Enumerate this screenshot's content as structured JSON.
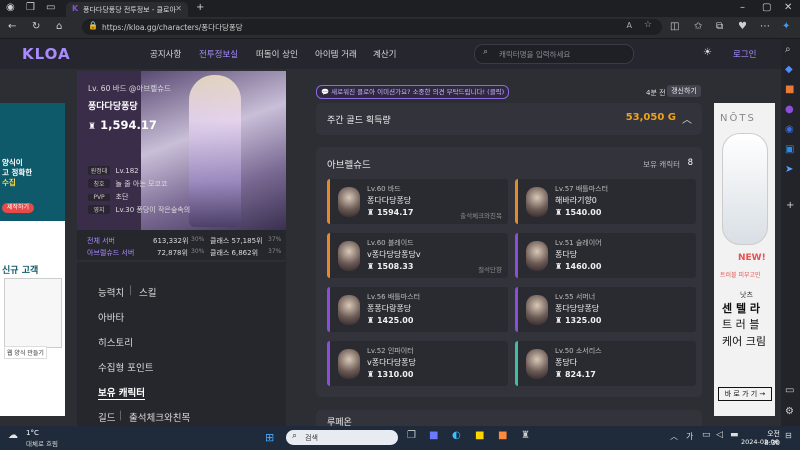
{
  "browser": {
    "tab_title": "퐁다다당퐁당 전투정보 - 클로아",
    "url": "https://kloa.gg/characters/퐁다다당퐁당"
  },
  "nav": {
    "logo": "KLOA",
    "items": [
      "공지사항",
      "전투정보실",
      "떠돌이 상인",
      "아이템 거래",
      "계산기"
    ],
    "search_placeholder": "캐릭터명을 입력하세요",
    "login": "로그인"
  },
  "profile": {
    "level_line": "Lv. 60 바드 @아브렐슈드",
    "name": "퐁다다당퐁당",
    "item_level": "1,594.17",
    "stats": [
      {
        "label": "원정대",
        "value": "Lv.182"
      },
      {
        "label": "칭호",
        "value": "놀 줄 아는 모코코"
      },
      {
        "label": "PVP",
        "value": "초단"
      },
      {
        "label": "영지",
        "value": "Lv.30 퐁당이 작은숲속의"
      }
    ],
    "ranks": [
      {
        "label": "전체 서버",
        "rank": "613,332위",
        "pct": "30%",
        "class": "클래스 57,185위",
        "class_pct": "37%"
      },
      {
        "label": "아브렐슈드 서버",
        "rank": "72,878위",
        "pct": "30%",
        "class": "클래스 6,862위",
        "class_pct": "37%"
      }
    ]
  },
  "menu": {
    "items": [
      "능력치",
      "스킬",
      "아바타",
      "히스토리",
      "수집형 포인트",
      "보유 캐릭터",
      "길드",
      "출석체크와친목"
    ]
  },
  "banner": "💬 새로워진 클로아 이미션가요? 소중한 의견 부탁드립니다! (클릭)",
  "update": {
    "ago": "4분 전",
    "button": "갱신하기"
  },
  "gold": {
    "label": "주간 골드 획득량",
    "value": "53,050 G"
  },
  "server": {
    "name": "아브렐슈드",
    "count_label": "보유 캐릭터",
    "count": "8",
    "characters": [
      {
        "cls": "Lv.60 바드",
        "name": "퐁다다당퐁당",
        "level": "1594.17",
        "note": "출석체크와친목",
        "color": "orange"
      },
      {
        "cls": "Lv.57 배틀마스터",
        "name": "해바라기향0",
        "level": "1540.00",
        "note": "",
        "color": "orange"
      },
      {
        "cls": "Lv.60 블레이드",
        "name": "v퐁다당당퐁당v",
        "level": "1508.33",
        "note": "절석단향",
        "color": "orange"
      },
      {
        "cls": "Lv.51 슬레이어",
        "name": "퐁다당",
        "level": "1460.00",
        "note": "",
        "color": "purple"
      },
      {
        "cls": "Lv.56 배틀마스터",
        "name": "퐁퐁다랑퐁당",
        "level": "1425.00",
        "note": "",
        "color": "purple"
      },
      {
        "cls": "Lv.55 서머너",
        "name": "퐁다당당퐁당",
        "level": "1325.00",
        "note": "",
        "color": "purple"
      },
      {
        "cls": "Lv.52 인파이터",
        "name": "v퐁다다당퐁당",
        "level": "1310.00",
        "note": "",
        "color": "purple"
      },
      {
        "cls": "Lv.50 소서리스",
        "name": "퐁당다",
        "level": "824.17",
        "note": "",
        "color": "teal"
      }
    ]
  },
  "next_section": "루페온",
  "ad_left": {
    "lines": [
      "양식이",
      "고 정확한",
      "수집"
    ],
    "btn": "제작하기",
    "title": "신규 고객",
    "sub": "웹 양식 만들기"
  },
  "ad_right": {
    "brand": "NŌTS",
    "new": "NEW!",
    "l1": "트러블 피부고민",
    "l2": "낫츠",
    "l3": "센 텔 라",
    "l4": "트 러 블",
    "l5": "케어 크림",
    "btn": "바 로 가 기 →"
  },
  "taskbar": {
    "weather": "1°C",
    "weather_desc": "대체로 흐림",
    "search": "검색",
    "time": "오전 8:30",
    "date": "2024-02-06",
    "lang": "가"
  },
  "colors": {
    "accent": "#e28a2c",
    "purple": "#8a4fd8",
    "teal": "#3fbfa0",
    "gold": "#f0a21d",
    "link": "#a88bff"
  }
}
